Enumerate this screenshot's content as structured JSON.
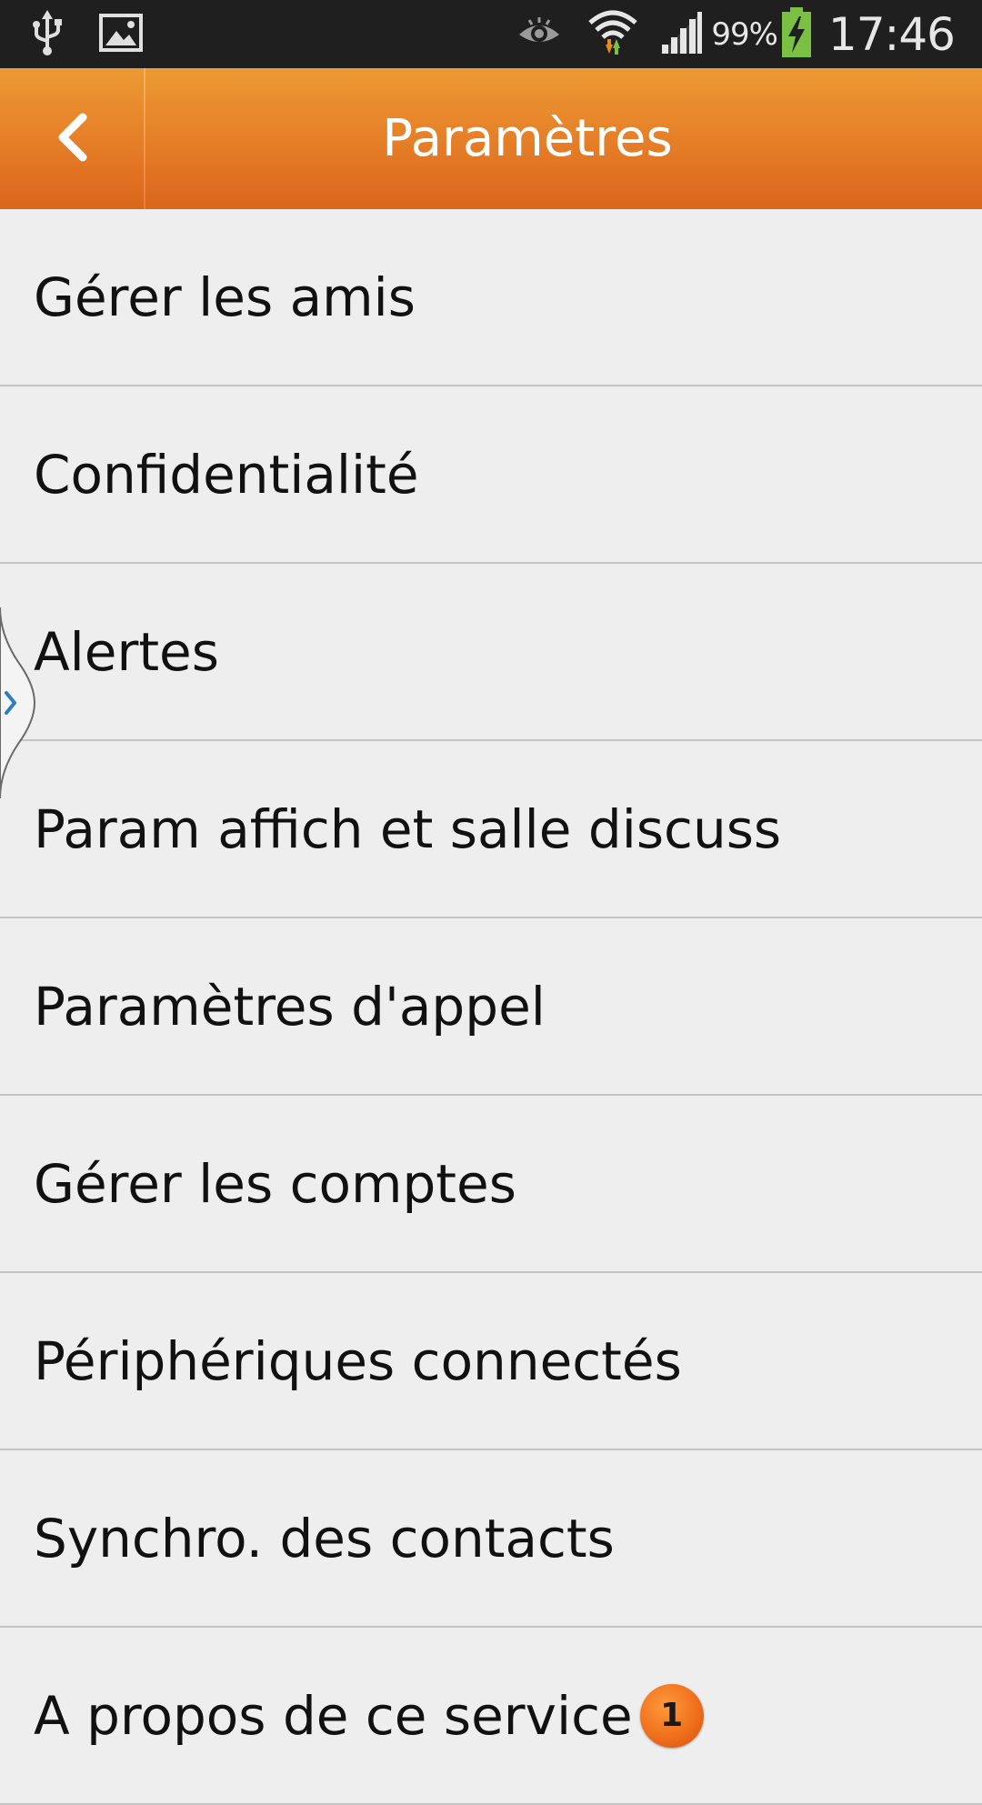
{
  "status_bar": {
    "left_icons": [
      "usb-icon",
      "picture-icon"
    ],
    "right_icons": [
      "eye-icon",
      "wifi-icon",
      "signal-icon",
      "battery-charging-icon"
    ],
    "battery_percent": "99%",
    "time": "17:46"
  },
  "action_bar": {
    "title": "Paramètres",
    "back_icon": "back-chevron-icon",
    "color": "#e57d27"
  },
  "settings": {
    "items": [
      {
        "label": "Gérer les amis"
      },
      {
        "label": "Confidentialité"
      },
      {
        "label": "Alertes"
      },
      {
        "label": "Param affich et salle discuss"
      },
      {
        "label": "Paramètres d'appel"
      },
      {
        "label": "Gérer les comptes"
      },
      {
        "label": "Périphériques connectés"
      },
      {
        "label": "Synchro. des contacts"
      },
      {
        "label": "A propos de ce service",
        "badge": "1"
      }
    ]
  },
  "edge_handle": {
    "icon": "chevron-right-icon"
  }
}
